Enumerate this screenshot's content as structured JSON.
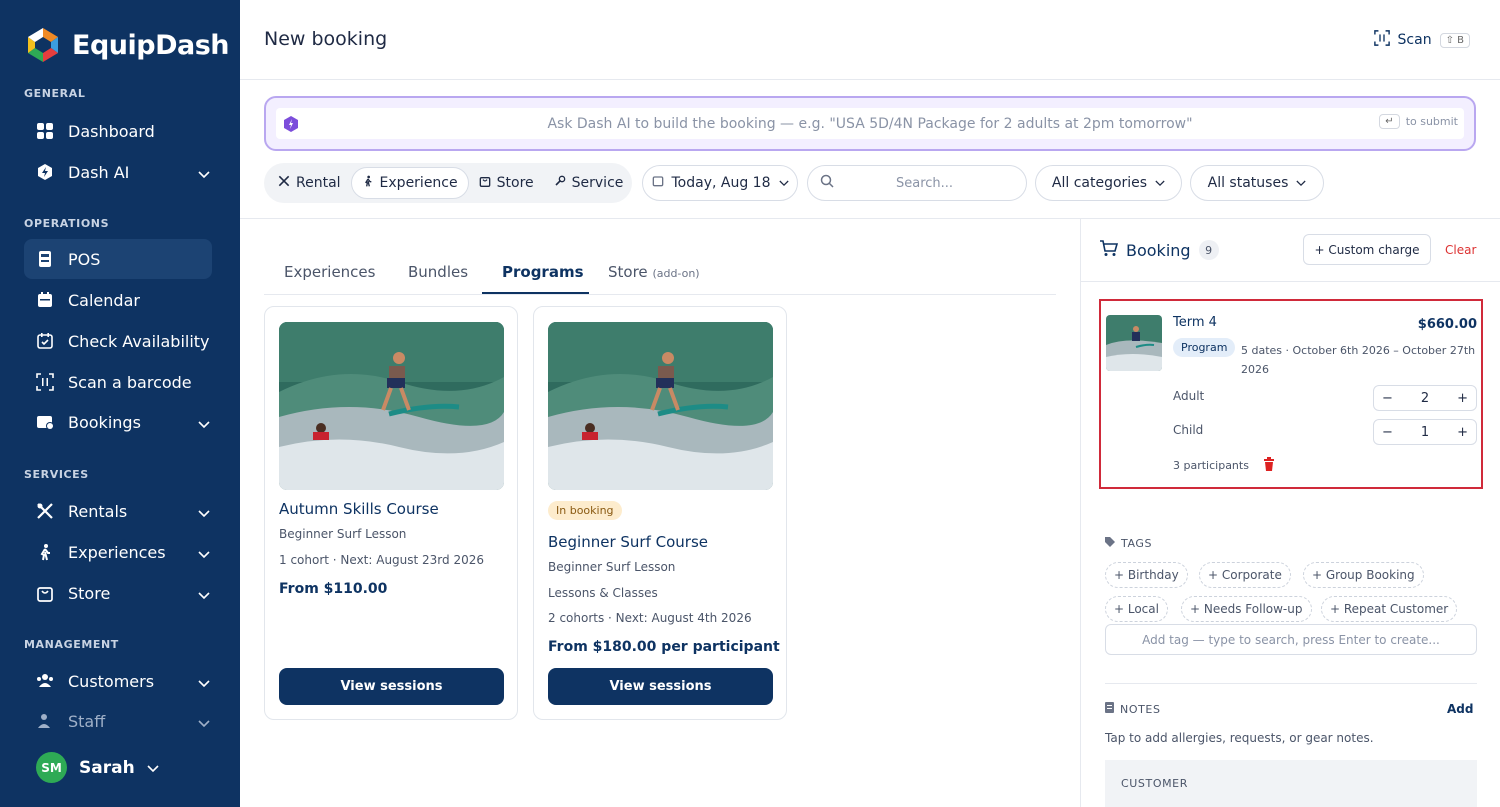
{
  "brand": {
    "name": "EquipDash"
  },
  "sidebar": {
    "sections": {
      "general": "GENERAL",
      "operations": "OPERATIONS",
      "services": "SERVICES",
      "management": "MANAGEMENT"
    },
    "items": {
      "dashboard": "Dashboard",
      "dash_ai": "Dash AI",
      "pos": "POS",
      "calendar": "Calendar",
      "check_availability": "Check Availability",
      "scan_barcode": "Scan a barcode",
      "bookings": "Bookings",
      "rentals": "Rentals",
      "experiences": "Experiences",
      "store": "Store",
      "customers": "Customers",
      "staff": "Staff"
    },
    "user": {
      "initials": "SM",
      "name": "Sarah"
    }
  },
  "header": {
    "title": "New booking",
    "scan_label": "Scan",
    "scan_shortcut": "⇧ B"
  },
  "ai_bar": {
    "placeholder": "Ask Dash AI to build the booking — e.g. \"USA 5D/4N Package for 2 adults at 2pm tomorrow\"",
    "submit_hint": "to submit"
  },
  "filters": {
    "types": {
      "rental": "Rental",
      "experience": "Experience",
      "store": "Store",
      "service": "Service"
    },
    "active_type": "Experience",
    "date": "Today, Aug 18",
    "search_placeholder": "Search...",
    "categories": "All categories",
    "statuses": "All statuses"
  },
  "tabs": {
    "experiences": "Experiences",
    "bundles": "Bundles",
    "programs": "Programs",
    "store": "Store",
    "store_note": "(add-on)",
    "active": "Programs"
  },
  "cards": [
    {
      "title": "Autumn Skills Course",
      "subtitle": "Beginner Surf Lesson",
      "schedule": "1 cohort · Next: August 23rd 2026",
      "price": "From $110.00",
      "button": "View sessions"
    },
    {
      "badge": "In booking",
      "title": "Beginner Surf Course",
      "subtitle": "Beginner Surf Lesson",
      "category": "Lessons & Classes",
      "schedule": "2 cohorts · Next: August 4th 2026",
      "price": "From $180.00 per participant",
      "button": "View sessions"
    }
  ],
  "booking": {
    "title": "Booking",
    "count": "9",
    "custom_charge": "+ Custom charge",
    "clear": "Clear",
    "item": {
      "title": "Term 4",
      "price": "$660.00",
      "chip": "Program",
      "dates": "5 dates · October 6th 2026 – October 27th 2026",
      "adult_label": "Adult",
      "adult_qty": "2",
      "child_label": "Child",
      "child_qty": "1",
      "participants": "3 participants"
    },
    "tags_label": "TAGS",
    "tags": [
      "+ Birthday",
      "+ Corporate",
      "+ Group Booking",
      "+ Local",
      "+ Needs Follow-up",
      "+ Repeat Customer"
    ],
    "tag_placeholder": "Add tag — type to search, press Enter to create...",
    "notes_label": "NOTES",
    "notes_add": "Add",
    "notes_hint": "Tap to add allergies, requests, or gear notes.",
    "customer_label": "CUSTOMER"
  },
  "colors": {
    "sidebar": "#0e3362",
    "primary": "#0e3362",
    "accent_ai": "#b9a7f0",
    "highlight": "#d02a3a",
    "badge_in_booking": "#fdeccd",
    "danger": "#dd2222"
  }
}
